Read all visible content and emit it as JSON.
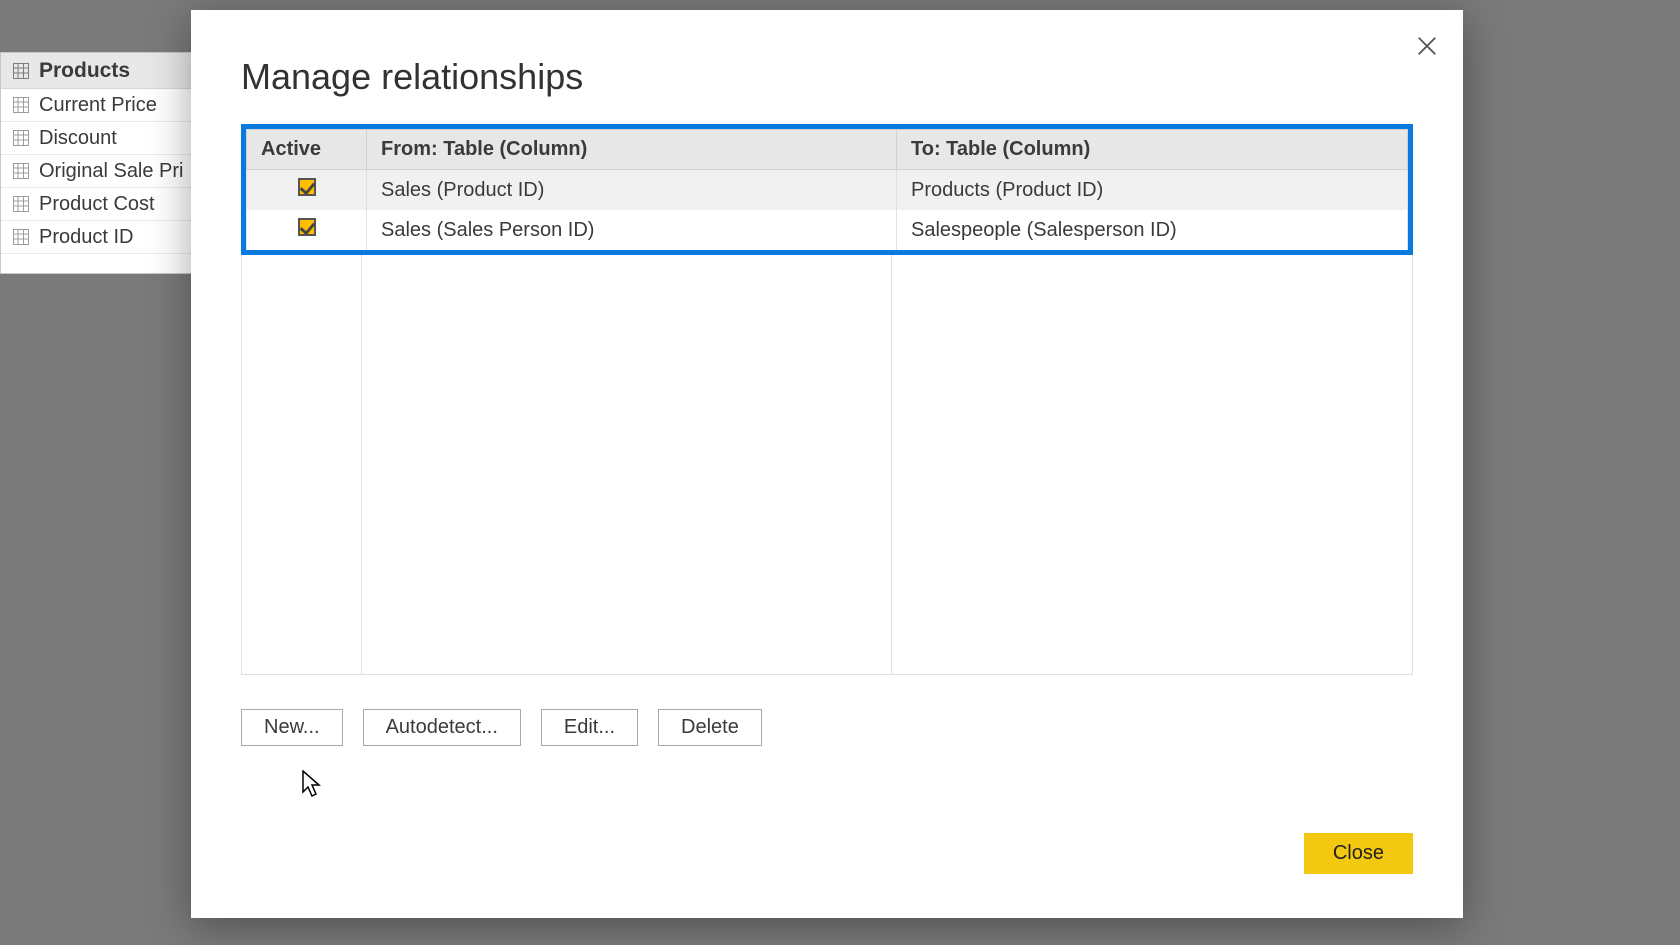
{
  "fields": {
    "header": "Products",
    "items": [
      "Current Price",
      "Discount",
      "Original Sale Pri",
      "Product Cost",
      "Product ID"
    ]
  },
  "dialog": {
    "title": "Manage relationships",
    "headers": {
      "active": "Active",
      "from": "From: Table (Column)",
      "to": "To: Table (Column)"
    },
    "rows": [
      {
        "active": true,
        "from": "Sales (Product ID)",
        "to": "Products (Product ID)"
      },
      {
        "active": true,
        "from": "Sales (Sales Person ID)",
        "to": "Salespeople (Salesperson ID)"
      }
    ],
    "buttons": {
      "new": "New...",
      "autodetect": "Autodetect...",
      "edit": "Edit...",
      "delete": "Delete",
      "close": "Close"
    }
  }
}
